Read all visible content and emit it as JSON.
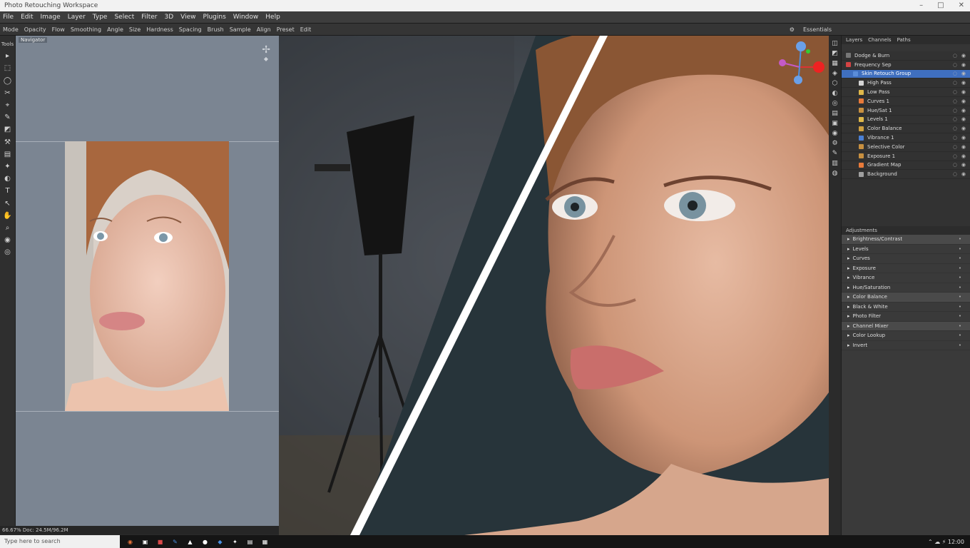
{
  "titlebar": {
    "title": "Photo Retouching Workspace",
    "min_glyph": "–",
    "max_glyph": "□",
    "close_glyph": "✕"
  },
  "menu": [
    "File",
    "Edit",
    "Image",
    "Layer",
    "Type",
    "Select",
    "Filter",
    "3D",
    "View",
    "Plugins",
    "Window",
    "Help"
  ],
  "options": [
    "Mode",
    "Opacity",
    "Flow",
    "Smoothing",
    "Angle",
    "Size",
    "Hardness",
    "Spacing",
    "Brush",
    "Sample",
    "Align",
    "Preset",
    "Edit"
  ],
  "options_right": {
    "icon": "⚙",
    "label": "Essentials"
  },
  "tools": [
    "▸",
    "⬚",
    "◯",
    "✂",
    "⌖",
    "✎",
    "◩",
    "⚒",
    "▤",
    "✦",
    "◐",
    "T",
    "↖",
    "✋",
    "⌕",
    "◉",
    "◎"
  ],
  "tool_label": "Tools",
  "navigator": {
    "tab": "Navigator",
    "move_glyph": "✢",
    "extra_glyph": "◆"
  },
  "layers": {
    "tabs": [
      "Layers",
      "Channels",
      "Paths"
    ],
    "rows": [
      {
        "name": "Dodge & Burn",
        "color": "#777777",
        "selected": false
      },
      {
        "name": "Frequency Sep",
        "color": "#d44444",
        "selected": false
      },
      {
        "name": "Skin Retouch Group",
        "color": "#5b8dd9",
        "selected": true
      },
      {
        "name": "High Pass",
        "color": "#d4d4d4",
        "selected": false
      },
      {
        "name": "Low Pass",
        "color": "#e0b84a",
        "selected": false
      },
      {
        "name": "Curves 1",
        "color": "#e87a3a",
        "selected": false
      },
      {
        "name": "Hue/Sat 1",
        "color": "#c89040",
        "selected": false
      },
      {
        "name": "Levels 1",
        "color": "#e0b84a",
        "selected": false
      },
      {
        "name": "Color Balance",
        "color": "#d0a040",
        "selected": false
      },
      {
        "name": "Vibrance 1",
        "color": "#4a7fd4",
        "selected": false
      },
      {
        "name": "Selective Color",
        "color": "#c89040",
        "selected": false
      },
      {
        "name": "Exposure 1",
        "color": "#c89040",
        "selected": false
      },
      {
        "name": "Gradient Map",
        "color": "#e87a3a",
        "selected": false
      },
      {
        "name": "Background",
        "color": "#a0a0a0",
        "selected": false
      }
    ],
    "eye_glyph": "◉",
    "lock_glyph": "◌"
  },
  "adjustments": {
    "tab": "Adjustments",
    "rows": [
      "Brightness/Contrast",
      "Levels",
      "Curves",
      "Exposure",
      "Vibrance",
      "Hue/Saturation",
      "Color Balance",
      "Black & White",
      "Photo Filter",
      "Channel Mixer",
      "Color Lookup",
      "Invert"
    ]
  },
  "statusbar": "66.67% Doc: 24.5M/96.2M",
  "taskbar": {
    "search": "Type here to search",
    "apps": [
      {
        "glyph": "◉",
        "color": "#e8733a"
      },
      {
        "glyph": "▣",
        "color": "#ffffff"
      },
      {
        "glyph": "■",
        "color": "#d94a4a"
      },
      {
        "glyph": "✎",
        "color": "#4a90e2"
      },
      {
        "glyph": "▲",
        "color": "#ffffff"
      },
      {
        "glyph": "●",
        "color": "#ffffff"
      },
      {
        "glyph": "◆",
        "color": "#4a90e2"
      },
      {
        "glyph": "✦",
        "color": "#ffffff"
      },
      {
        "glyph": "▤",
        "color": "#ffffff"
      },
      {
        "glyph": "▦",
        "color": "#ffffff"
      }
    ],
    "tray": "⌃ ☁ ⚡ 12:00"
  }
}
